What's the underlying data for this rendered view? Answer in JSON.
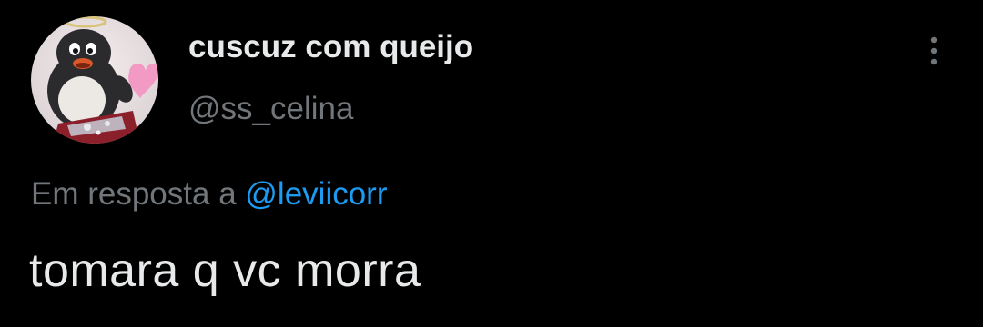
{
  "tweet": {
    "author": {
      "display_name": "cuscuz com queijo",
      "handle": "@ss_celina",
      "avatar_icon": "penguin-avatar-icon"
    },
    "reply_context": {
      "prefix": "Em resposta a",
      "mention": "@leviicorr"
    },
    "text": "tomara q vc morra",
    "menu_icon": "more-vertical-icon"
  },
  "colors": {
    "background": "#000000",
    "primary_text": "#e7e9ea",
    "secondary_text": "#71767b",
    "link": "#1d9bf0"
  }
}
